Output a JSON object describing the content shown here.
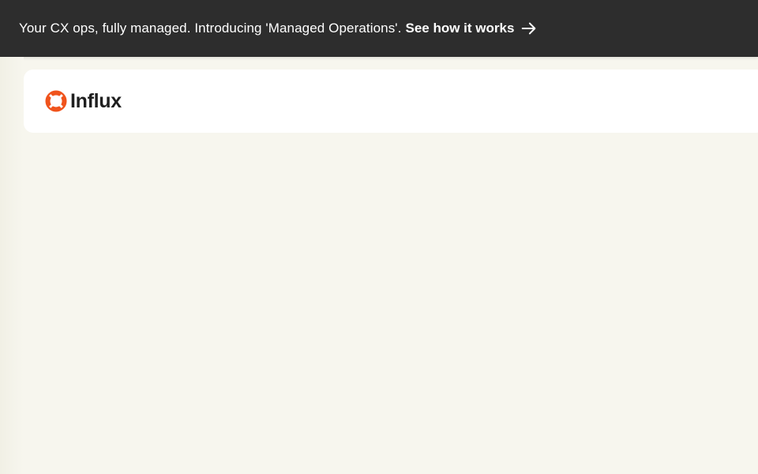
{
  "announcement": {
    "text": "Your CX ops, fully managed. Introducing 'Managed Operations'.",
    "link_label": "See how it works",
    "link_icon": "arrow-right-icon",
    "background_color": "#2d2d2d",
    "text_color": "#ffffff"
  },
  "header": {
    "logo": {
      "icon": "lifebuoy-logo-icon",
      "text": "Influx",
      "accent_color": "#f0531c"
    },
    "card_color": "#ffffff"
  },
  "page": {
    "background_color": "#f7f6ee"
  }
}
